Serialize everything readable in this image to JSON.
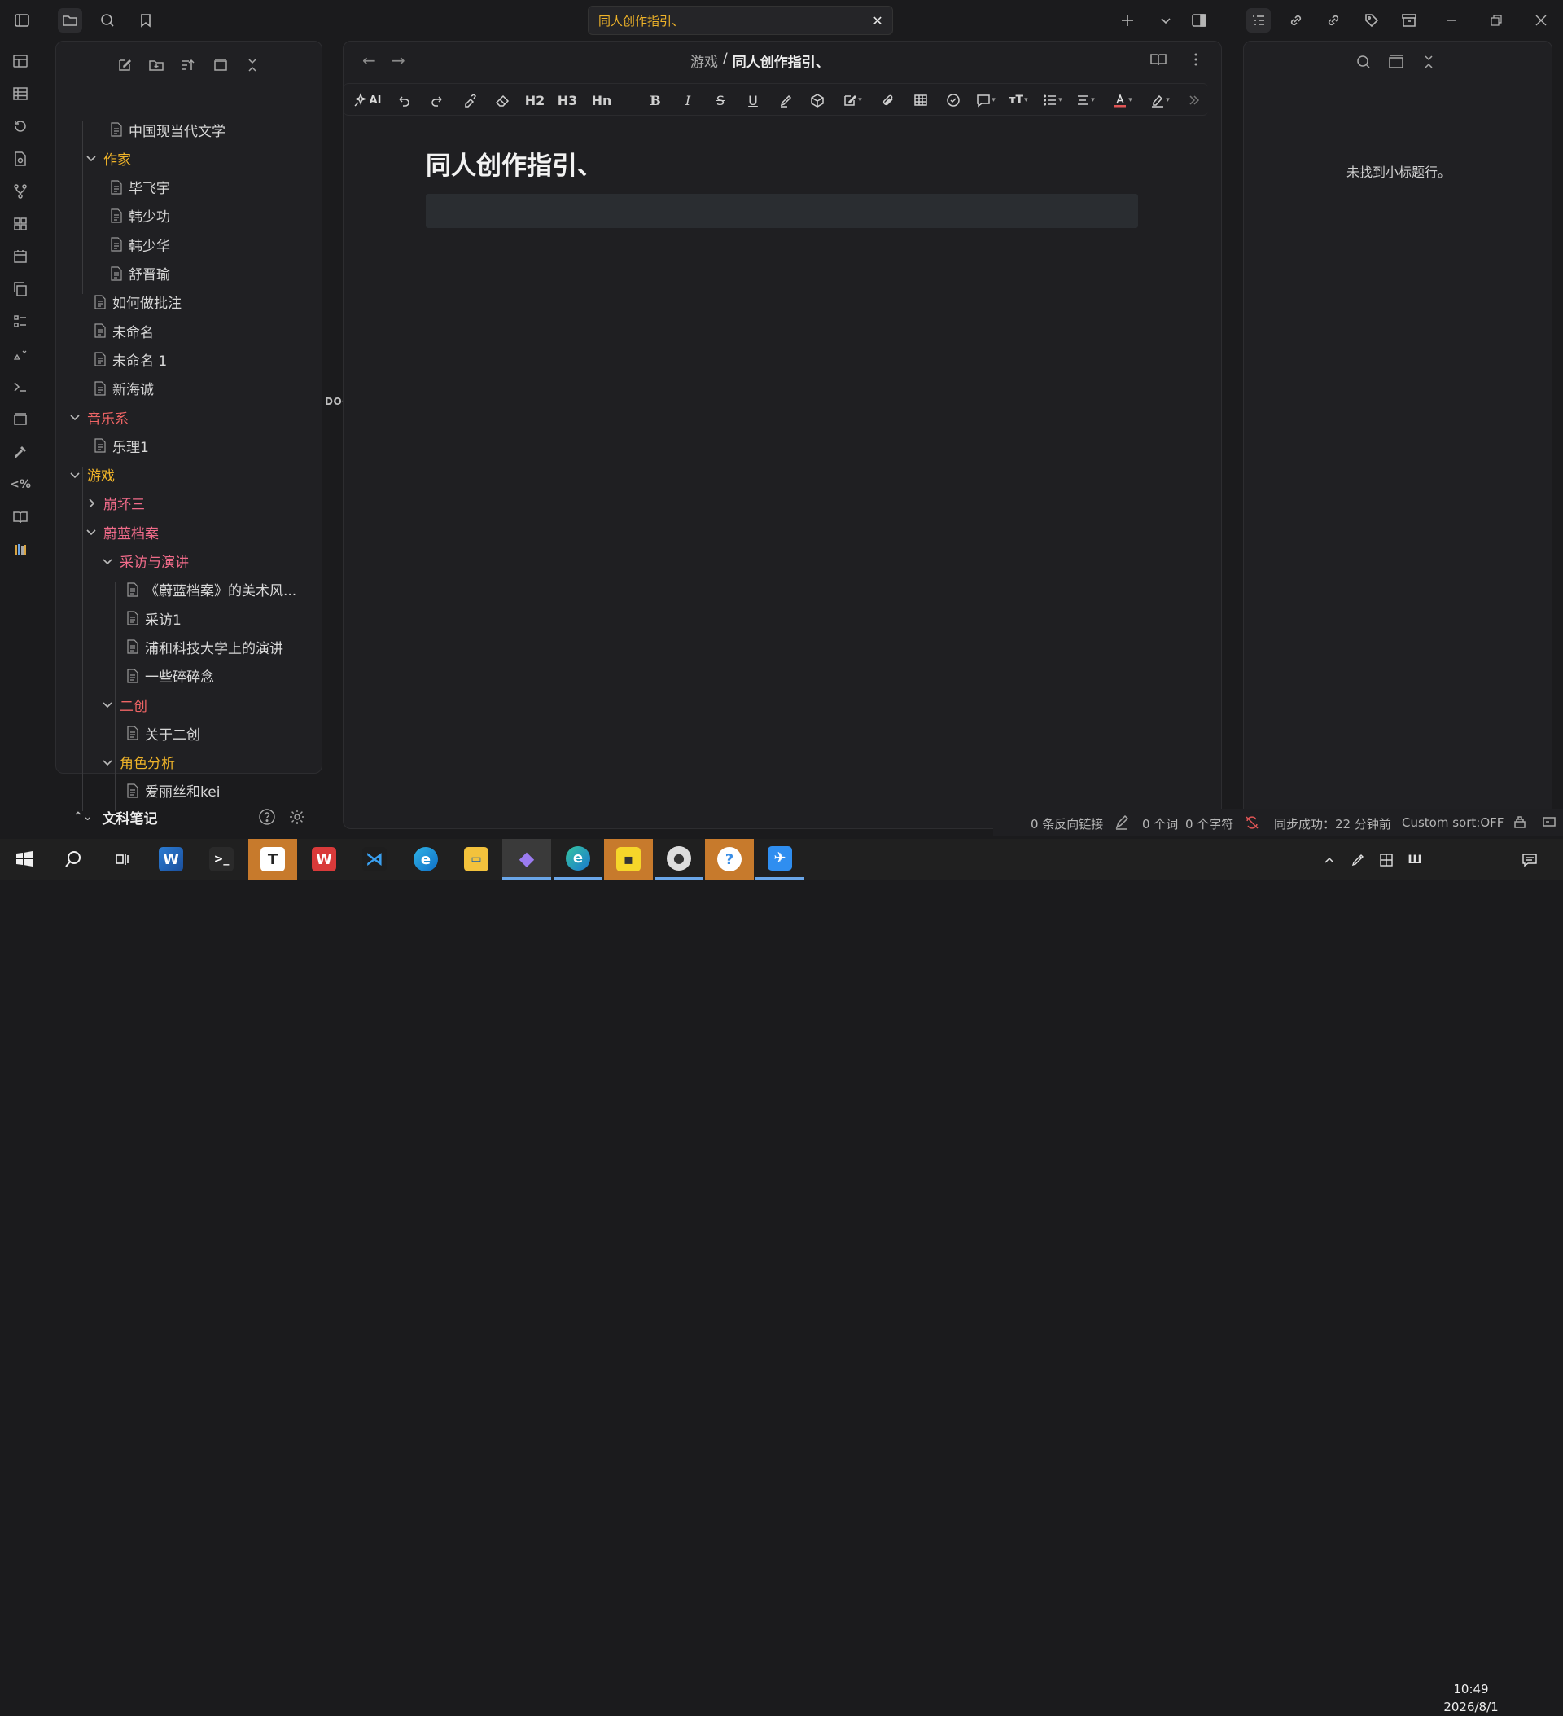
{
  "tab": {
    "title": "同人创作指引、",
    "close": "✕"
  },
  "explorer": {
    "items": [
      {
        "label": "中国现当代文学",
        "kind": "file",
        "level": 2
      },
      {
        "label": "作家",
        "kind": "folder-open",
        "level": 1,
        "color": "yellow"
      },
      {
        "label": "毕飞宇",
        "kind": "file",
        "level": 2
      },
      {
        "label": "韩少功",
        "kind": "file",
        "level": 2
      },
      {
        "label": "韩少华",
        "kind": "file",
        "level": 2
      },
      {
        "label": "舒晋瑜",
        "kind": "file",
        "level": 2
      },
      {
        "label": "如何做批注",
        "kind": "file",
        "level": 1
      },
      {
        "label": "未命名",
        "kind": "file",
        "level": 1
      },
      {
        "label": "未命名 1",
        "kind": "file",
        "level": 1
      },
      {
        "label": "新海诚",
        "kind": "file",
        "level": 1
      },
      {
        "label": "音乐系",
        "kind": "folder-open",
        "level": 0,
        "color": "red"
      },
      {
        "label": "乐理1",
        "kind": "file",
        "level": 1
      },
      {
        "label": "游戏",
        "kind": "folder-open",
        "level": 0,
        "color": "yellow"
      },
      {
        "label": "崩坏三",
        "kind": "folder-closed",
        "level": 1,
        "color": "pink"
      },
      {
        "label": "蔚蓝档案",
        "kind": "folder-open",
        "level": 1,
        "color": "pink"
      },
      {
        "label": "采访与演讲",
        "kind": "folder-open",
        "level": 2,
        "color": "pink"
      },
      {
        "label": "《蔚蓝档案》的美术风...",
        "kind": "file",
        "level": 3
      },
      {
        "label": "采访1",
        "kind": "file",
        "level": 3
      },
      {
        "label": "浦和科技大学上的演讲",
        "kind": "file",
        "level": 3
      },
      {
        "label": "一些碎碎念",
        "kind": "file",
        "level": 3
      },
      {
        "label": "二创",
        "kind": "folder-open",
        "level": 2,
        "color": "red"
      },
      {
        "label": "关于二创",
        "kind": "file",
        "level": 3
      },
      {
        "label": "角色分析",
        "kind": "folder-open",
        "level": 2,
        "color": "yellow"
      },
      {
        "label": "爱丽丝和kei",
        "kind": "file",
        "level": 3
      }
    ],
    "docx_badge": "DOCX",
    "vault_name": "文科笔记",
    "vault_switch": "⌃⌄"
  },
  "editor": {
    "breadcrumb_parent": "游戏",
    "breadcrumb_sep": "/",
    "breadcrumb_current": "同人创作指引、",
    "doc_title": "同人创作指引、",
    "toolbar": {
      "ai": "AI",
      "h2": "H2",
      "h3": "H3",
      "hn": "Hn",
      "bold": "B",
      "italic": "I",
      "strike": "S",
      "underline": "U"
    }
  },
  "outline": {
    "empty_text": "未找到小标题行。"
  },
  "status": {
    "backlinks": "0 条反向链接",
    "words": "0 个词",
    "chars": "0 个字符",
    "sync": "同步成功：22 分钟前",
    "sort": "Custom sort:OFF"
  },
  "taskbar": {
    "time": "10:49",
    "date": "2026/8/1"
  }
}
